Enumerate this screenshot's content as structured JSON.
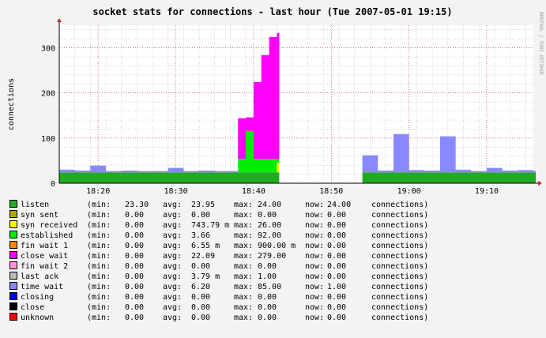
{
  "chart_data": {
    "type": "area",
    "title": "socket stats for connections - last hour (Tue 2007-05-01 19:15)",
    "ylabel": "connections",
    "watermark": "RRDTOOL / TOBI OETIKER",
    "xlim": [
      "18:15",
      "19:16"
    ],
    "ylim": [
      0,
      350
    ],
    "y_ticks": [
      0,
      100,
      200,
      300
    ],
    "x_ticks": [
      "18:20",
      "18:30",
      "18:40",
      "18:50",
      "19:00",
      "19:10"
    ],
    "grid": true,
    "stacked": true,
    "gap": [
      "18:44",
      "18:52"
    ],
    "x": [
      "18:15",
      "18:17",
      "18:19",
      "18:21",
      "18:23",
      "18:25",
      "18:27",
      "18:29",
      "18:31",
      "18:33",
      "18:35",
      "18:37",
      "18:38",
      "18:39",
      "18:40",
      "18:41",
      "18:42",
      "18:43",
      "18:44",
      "18:52",
      "18:54",
      "18:56",
      "18:58",
      "19:00",
      "19:02",
      "19:04",
      "19:06",
      "19:08",
      "19:10",
      "19:12",
      "19:14",
      "19:16"
    ],
    "series": [
      {
        "name": "listen",
        "color": "#22aa22",
        "values": [
          24,
          24,
          24,
          24,
          24,
          24,
          24,
          24,
          24,
          24,
          24,
          24,
          24,
          24,
          24,
          24,
          24,
          24,
          null,
          null,
          24,
          24,
          24,
          24,
          24,
          24,
          24,
          24,
          24,
          24,
          24,
          24
        ]
      },
      {
        "name": "syn received",
        "color": "#ffff00",
        "values": [
          0,
          0,
          0,
          0,
          0,
          0,
          0,
          0,
          0,
          0,
          0,
          0,
          0,
          0,
          0,
          0,
          0,
          22,
          null,
          null,
          0,
          0,
          0,
          0,
          0,
          0,
          0,
          0,
          0,
          0,
          0,
          0
        ]
      },
      {
        "name": "established",
        "color": "#00ee00",
        "values": [
          0,
          0,
          0,
          0,
          0,
          0,
          0,
          0,
          0,
          0,
          0,
          0,
          30,
          92,
          30,
          30,
          30,
          8,
          null,
          null,
          0,
          0,
          0,
          0,
          0,
          0,
          0,
          0,
          0,
          0,
          0,
          0
        ]
      },
      {
        "name": "close wait",
        "color": "#ff00ff",
        "values": [
          0,
          0,
          0,
          0,
          0,
          0,
          0,
          0,
          0,
          0,
          0,
          0,
          90,
          30,
          170,
          230,
          270,
          279,
          null,
          null,
          0,
          0,
          0,
          0,
          0,
          0,
          0,
          0,
          0,
          0,
          0,
          0
        ]
      },
      {
        "name": "time wait",
        "color": "#8888ff",
        "values": [
          6,
          4,
          15,
          3,
          4,
          3,
          3,
          10,
          3,
          4,
          3,
          3,
          0,
          0,
          0,
          0,
          0,
          0,
          null,
          null,
          38,
          4,
          85,
          5,
          4,
          80,
          6,
          3,
          10,
          4,
          5,
          3
        ]
      }
    ],
    "legend": [
      {
        "label": "listen",
        "color": "#22aa22",
        "min": "23.30",
        "avg": "23.95",
        "max": "24.00",
        "now": "24.00"
      },
      {
        "label": "syn sent",
        "color": "#aaaa00",
        "min": "0.00",
        "avg": "0.00",
        "max": "0.00",
        "now": "0.00"
      },
      {
        "label": "syn received",
        "color": "#ffff00",
        "min": "0.00",
        "avg": "743.79 m",
        "max": "26.00",
        "now": "0.00"
      },
      {
        "label": "established",
        "color": "#00ee00",
        "min": "0.00",
        "avg": "3.66",
        "max": "92.00",
        "now": "0.00"
      },
      {
        "label": "fin wait 1",
        "color": "#ff8800",
        "min": "0.00",
        "avg": "6.55 m",
        "max": "900.00 m",
        "now": "0.00"
      },
      {
        "label": "close wait",
        "color": "#ff00ff",
        "min": "0.00",
        "avg": "22.09",
        "max": "279.00",
        "now": "0.00"
      },
      {
        "label": "fin wait 2",
        "color": "#ff99dd",
        "min": "0.00",
        "avg": "0.00",
        "max": "0.00",
        "now": "0.00"
      },
      {
        "label": "last ack",
        "color": "#bbbbbb",
        "min": "0.00",
        "avg": "3.79 m",
        "max": "1.00",
        "now": "0.00"
      },
      {
        "label": "time wait",
        "color": "#8888ff",
        "min": "0.00",
        "avg": "6.20",
        "max": "85.00",
        "now": "1.00"
      },
      {
        "label": "closing",
        "color": "#0000ff",
        "min": "0.00",
        "avg": "0.00",
        "max": "0.00",
        "now": "0.00"
      },
      {
        "label": "close",
        "color": "#000000",
        "min": "0.00",
        "avg": "0.00",
        "max": "0.00",
        "now": "0.00"
      },
      {
        "label": "unknown",
        "color": "#ff0000",
        "min": "0.00",
        "avg": "0.00",
        "max": "0.00",
        "now": "0.00"
      }
    ],
    "legend_keys": {
      "min": "(min:",
      "avg": "avg:",
      "max": "max:",
      "now": "now:",
      "unit": "connections)"
    }
  }
}
